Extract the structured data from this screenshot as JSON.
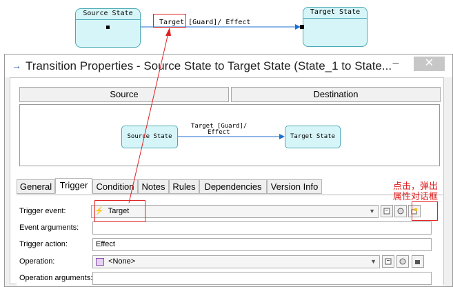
{
  "diagram": {
    "source_state": "Source State",
    "target_state": "Target State",
    "transition_label": "Target [Guard]/ Effect"
  },
  "dialog": {
    "title": "Transition Properties - Source State to Target State (State_1 to State...",
    "minimize_glyph": "–",
    "close_glyph": "✕",
    "source_button": "Source",
    "destination_button": "Destination",
    "preview": {
      "source_state": "Source State",
      "target_state": "Target State",
      "label_line1": "Target [Guard]/",
      "label_line2": "Effect"
    },
    "tabs": [
      {
        "label": "General",
        "active": false
      },
      {
        "label": "Trigger",
        "active": true
      },
      {
        "label": "Condition",
        "active": false
      },
      {
        "label": "Notes",
        "active": false
      },
      {
        "label": "Rules",
        "active": false
      },
      {
        "label": "Dependencies",
        "active": false
      },
      {
        "label": "Version Info",
        "active": false
      }
    ],
    "fields": {
      "trigger_event_label": "Trigger event:",
      "trigger_event_value": "Target",
      "event_arguments_label": "Event arguments:",
      "event_arguments_value": "",
      "trigger_action_label": "Trigger action:",
      "trigger_action_value": "Effect",
      "operation_label": "Operation:",
      "operation_value": "<None>",
      "operation_arguments_label": "Operation arguments:",
      "operation_arguments_value": ""
    }
  },
  "annotation": {
    "line1": "点击，弹出",
    "line2": "属性对话框",
    "color": "#e02020"
  },
  "colors": {
    "state_fill": "#d6f5f8",
    "state_border": "#4aa9b4",
    "transition_line": "#1e6fd0"
  }
}
